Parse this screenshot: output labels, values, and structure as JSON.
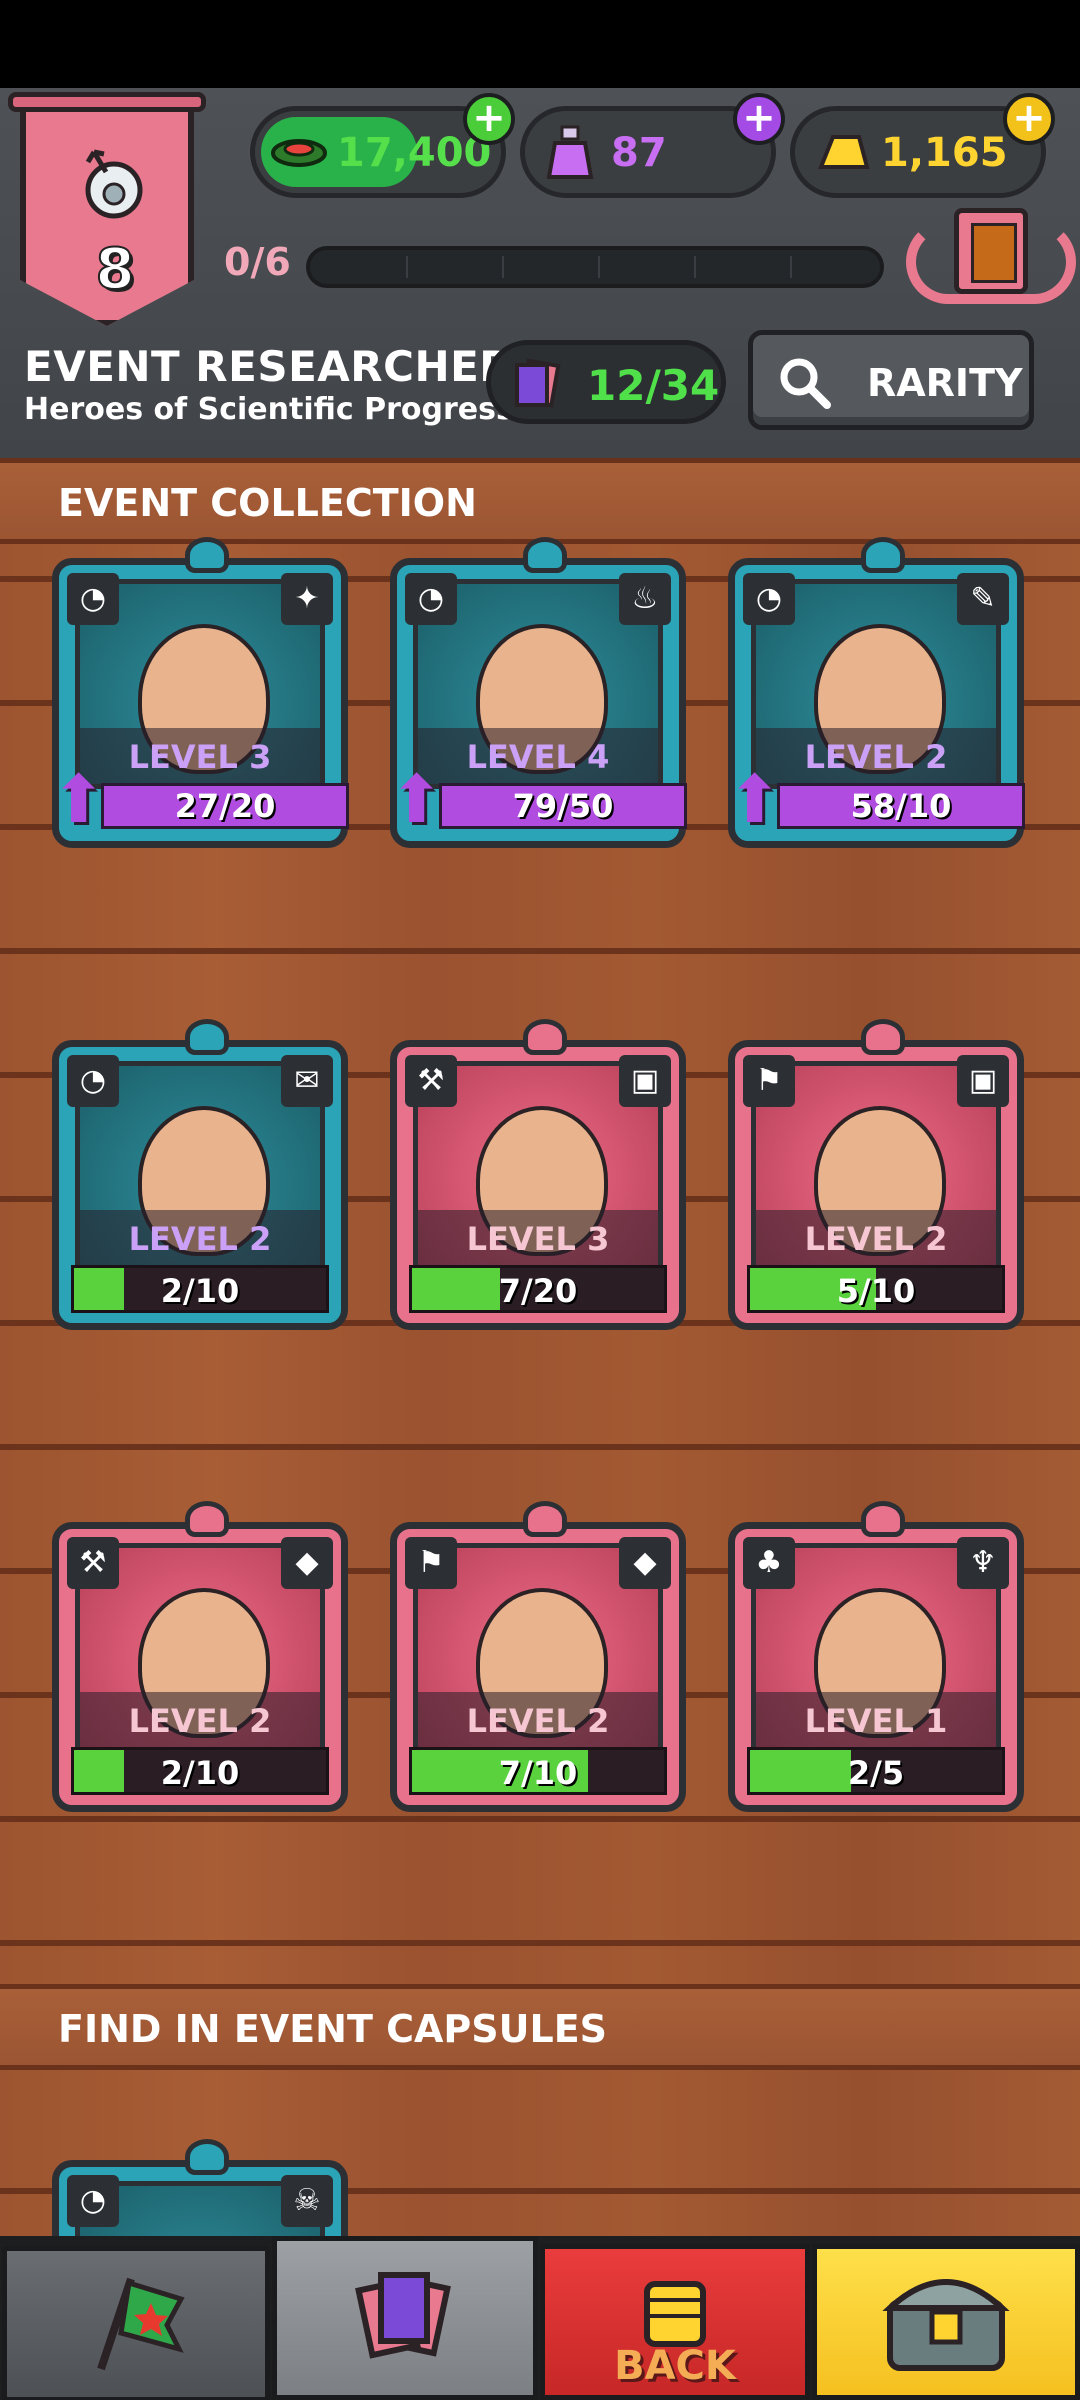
{
  "header": {
    "player_level": "8",
    "xp": "0/6",
    "currencies": [
      {
        "name": "cash",
        "value": "17,400",
        "color": "#55e04b"
      },
      {
        "name": "potions",
        "value": "87",
        "color": "#c86ef2"
      },
      {
        "name": "gold",
        "value": "1,165",
        "color": "#ffd430"
      }
    ]
  },
  "event": {
    "title": "EVENT RESEARCHERS",
    "subtitle": "Heroes of Scientific Progress",
    "collected": "12/34",
    "rarity_label": "RARITY"
  },
  "sections": {
    "collection_title": "EVENT COLLECTION",
    "capsules_title": "FIND IN EVENT CAPSULES"
  },
  "cards": [
    {
      "level": "LEVEL 3",
      "progress": "27/20",
      "fill": 1.0,
      "rarity": "blue",
      "upgrade": true
    },
    {
      "level": "LEVEL 4",
      "progress": "79/50",
      "fill": 1.0,
      "rarity": "blue",
      "upgrade": true
    },
    {
      "level": "LEVEL 2",
      "progress": "58/10",
      "fill": 1.0,
      "rarity": "blue",
      "upgrade": true
    },
    {
      "level": "LEVEL 2",
      "progress": "2/10",
      "fill": 0.2,
      "rarity": "blue",
      "upgrade": false
    },
    {
      "level": "LEVEL 3",
      "progress": "7/20",
      "fill": 0.35,
      "rarity": "pink",
      "upgrade": false
    },
    {
      "level": "LEVEL 2",
      "progress": "5/10",
      "fill": 0.5,
      "rarity": "pink",
      "upgrade": false
    },
    {
      "level": "LEVEL 2",
      "progress": "2/10",
      "fill": 0.2,
      "rarity": "pink",
      "upgrade": false
    },
    {
      "level": "LEVEL 2",
      "progress": "7/10",
      "fill": 0.7,
      "rarity": "pink",
      "upgrade": false
    },
    {
      "level": "LEVEL 1",
      "progress": "2/5",
      "fill": 0.4,
      "rarity": "pink",
      "upgrade": false
    }
  ],
  "nav": {
    "back_label": "BACK"
  }
}
